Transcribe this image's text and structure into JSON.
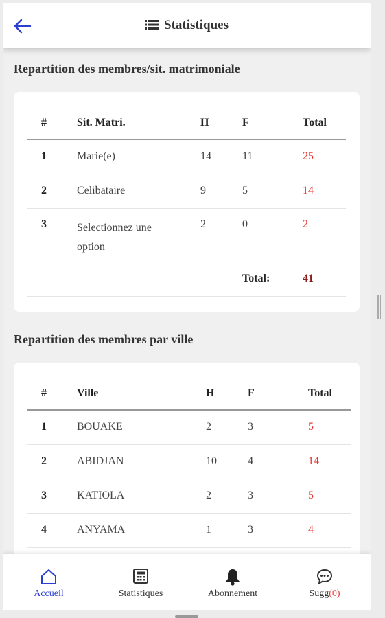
{
  "header": {
    "title": "Statistiques"
  },
  "matrimonial": {
    "title": "Repartition des membres/sit. matrimoniale",
    "columns": [
      "#",
      "Sit. Matri.",
      "H",
      "F",
      "Total"
    ],
    "rows": [
      {
        "n": "1",
        "label": "Marie(e)",
        "h": "14",
        "f": "11",
        "total": "25"
      },
      {
        "n": "2",
        "label": "Celibataire",
        "h": "9",
        "f": "5",
        "total": "14"
      },
      {
        "n": "3",
        "label": "Selectionnez une option",
        "h": "2",
        "f": "0",
        "total": "2"
      }
    ],
    "total_label": "Total:",
    "total_value": "41"
  },
  "ville": {
    "title": "Repartition des membres par ville",
    "columns": [
      "#",
      "Ville",
      "H",
      "F",
      "Total"
    ],
    "rows": [
      {
        "n": "1",
        "label": "BOUAKE",
        "h": "2",
        "f": "3",
        "total": "5"
      },
      {
        "n": "2",
        "label": "ABIDJAN",
        "h": "10",
        "f": "4",
        "total": "14"
      },
      {
        "n": "3",
        "label": "KATIOLA",
        "h": "2",
        "f": "3",
        "total": "5"
      },
      {
        "n": "4",
        "label": "ANYAMA",
        "h": "1",
        "f": "3",
        "total": "4"
      }
    ]
  },
  "nav": {
    "accueil": "Accueil",
    "statistiques": "Statistiques",
    "abonnement": "Abonnement",
    "sugg_label": "Sugg",
    "sugg_count": "(0)"
  },
  "colors": {
    "accent": "#2b3fd1",
    "total": "#e53935",
    "grand_total": "#8b1a1a"
  }
}
